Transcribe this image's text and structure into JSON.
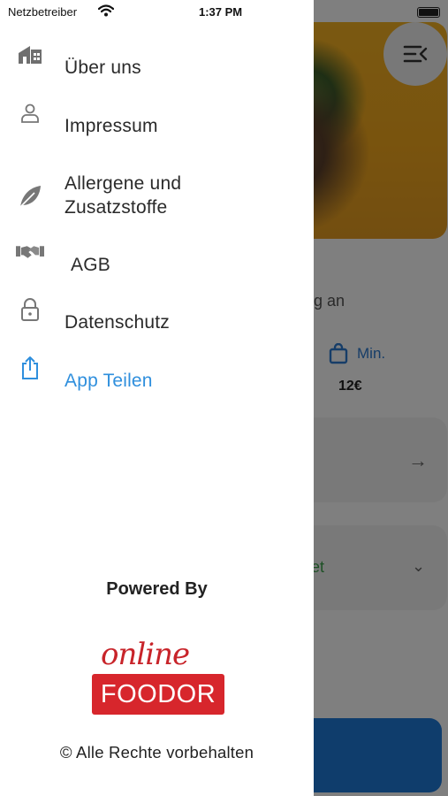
{
  "status_bar": {
    "carrier": "Netzbetreiber",
    "time": "1:37 PM"
  },
  "background": {
    "partial_text": "ng an",
    "min_label": "Min.",
    "min_price": "12€",
    "partial_green_text": "et"
  },
  "menu": {
    "items": [
      {
        "label": "Über uns",
        "icon": "store-icon"
      },
      {
        "label": "Impressum",
        "icon": "person-icon"
      },
      {
        "label": "Allergene und Zusatzstoffe",
        "line1": "Allergene und",
        "line2": "Zusatzstoffe",
        "icon": "leaf-icon"
      },
      {
        "label": "AGB",
        "icon": "handshake-icon"
      },
      {
        "label": "Datenschutz",
        "icon": "lock-icon"
      },
      {
        "label": "App Teilen",
        "icon": "share-icon"
      }
    ]
  },
  "footer": {
    "powered_by": "Powered By",
    "logo_script": "online",
    "logo_box": "FOODOR",
    "rights": "© Alle Rechte vorbehalten"
  },
  "colors": {
    "accent_blue": "#2f8fdd",
    "brand_red": "#d7262c"
  }
}
